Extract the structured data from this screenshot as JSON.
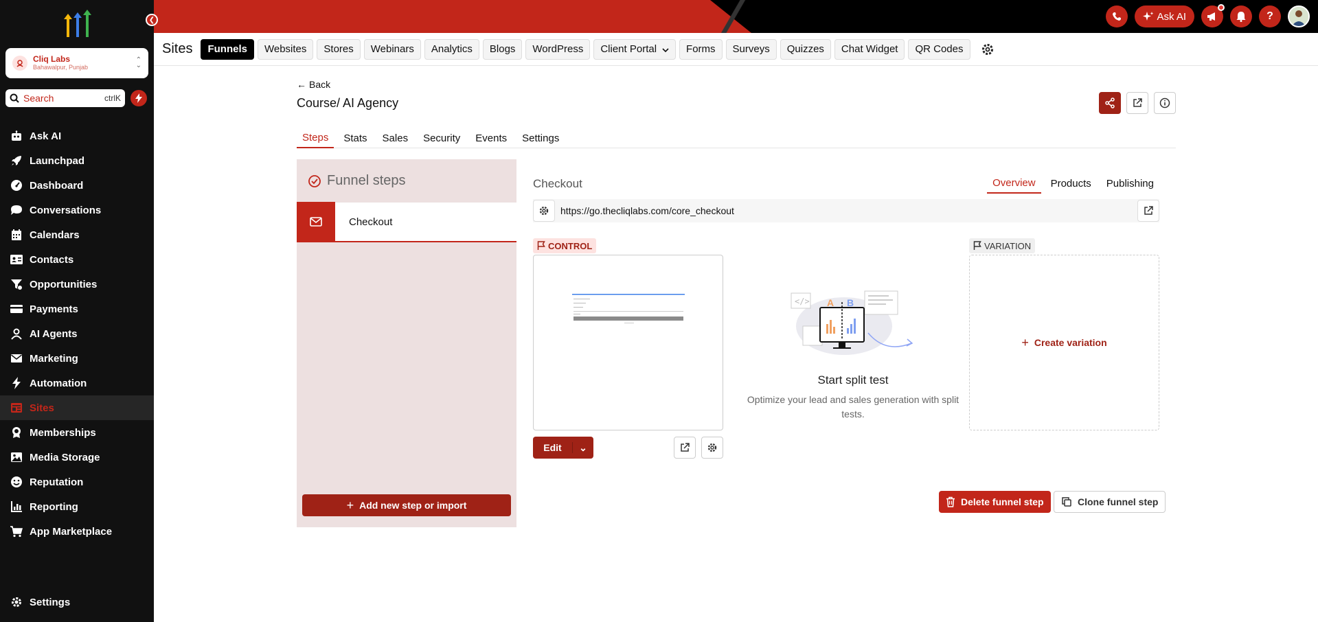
{
  "sidebar": {
    "account": {
      "name": "Cliq Labs",
      "location": "Bahawalpur, Punjab"
    },
    "search": {
      "placeholder": "Search",
      "shortcut": "ctrlK"
    },
    "items": [
      {
        "label": "Ask AI",
        "icon": "robot-icon"
      },
      {
        "label": "Launchpad",
        "icon": "rocket-icon"
      },
      {
        "label": "Dashboard",
        "icon": "gauge-icon"
      },
      {
        "label": "Conversations",
        "icon": "chat-icon"
      },
      {
        "label": "Calendars",
        "icon": "calendar-icon"
      },
      {
        "label": "Contacts",
        "icon": "contact-card-icon"
      },
      {
        "label": "Opportunities",
        "icon": "funnel-icon"
      },
      {
        "label": "Payments",
        "icon": "credit-card-icon"
      },
      {
        "label": "AI Agents",
        "icon": "agent-icon"
      },
      {
        "label": "Marketing",
        "icon": "mail-icon"
      },
      {
        "label": "Automation",
        "icon": "bolt-icon"
      },
      {
        "label": "Sites",
        "icon": "sites-icon",
        "active": true
      },
      {
        "label": "Memberships",
        "icon": "badge-icon"
      },
      {
        "label": "Media Storage",
        "icon": "image-icon"
      },
      {
        "label": "Reputation",
        "icon": "smile-icon"
      },
      {
        "label": "Reporting",
        "icon": "chart-icon"
      },
      {
        "label": "App Marketplace",
        "icon": "cart-icon"
      }
    ],
    "settings_label": "Settings"
  },
  "topbar": {
    "ask_ai_label": "Ask AI"
  },
  "subnav": {
    "title": "Sites",
    "tabs": [
      "Funnels",
      "Websites",
      "Stores",
      "Webinars",
      "Analytics",
      "Blogs",
      "WordPress",
      "Client Portal",
      "Forms",
      "Surveys",
      "Quizzes",
      "Chat Widget",
      "QR Codes"
    ],
    "active_tab": "Funnels"
  },
  "page": {
    "back_label": "Back",
    "title": "Course/ AI Agency",
    "tabs": [
      "Steps",
      "Stats",
      "Sales",
      "Security",
      "Events",
      "Settings"
    ]
  },
  "steps_panel": {
    "heading": "Funnel steps",
    "steps": [
      {
        "label": "Checkout"
      }
    ],
    "add_label": "Add new step or import"
  },
  "detail": {
    "title": "Checkout",
    "tabs": [
      "Overview",
      "Products",
      "Publishing"
    ],
    "url": "https://go.thecliqlabs.com/core_checkout",
    "control_label": "CONTROL",
    "variation_label": "VARIATION",
    "edit_label": "Edit",
    "split_title": "Start split test",
    "split_desc": "Optimize your lead and sales generation with split tests.",
    "create_variation_label": "Create variation",
    "delete_label": "Delete funnel step",
    "clone_label": "Clone funnel step",
    "illustration_letters": {
      "a": "A",
      "b": "B"
    }
  },
  "colors": {
    "brand": "#c2261a",
    "brand_dark": "#9f2216",
    "sidebar_bg": "#111111",
    "panel_bg": "#ede0e0"
  }
}
